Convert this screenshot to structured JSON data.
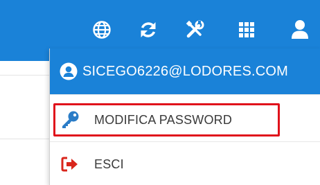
{
  "topbar": {
    "icons": [
      "globe-icon",
      "refresh-icon",
      "tools-icon",
      "apps-grid-icon",
      "user-icon"
    ]
  },
  "user_menu": {
    "email": "SICEGO6226@LODORES.COM",
    "items": [
      {
        "label": "MODIFICA PASSWORD",
        "icon": "key-icon"
      },
      {
        "label": "ESCI",
        "icon": "logout-icon"
      }
    ]
  },
  "colors": {
    "header_blue": "#1a82d8",
    "key_blue": "#2a7cc7",
    "logout_red": "#d9261c",
    "highlight_red": "#e0111b"
  }
}
